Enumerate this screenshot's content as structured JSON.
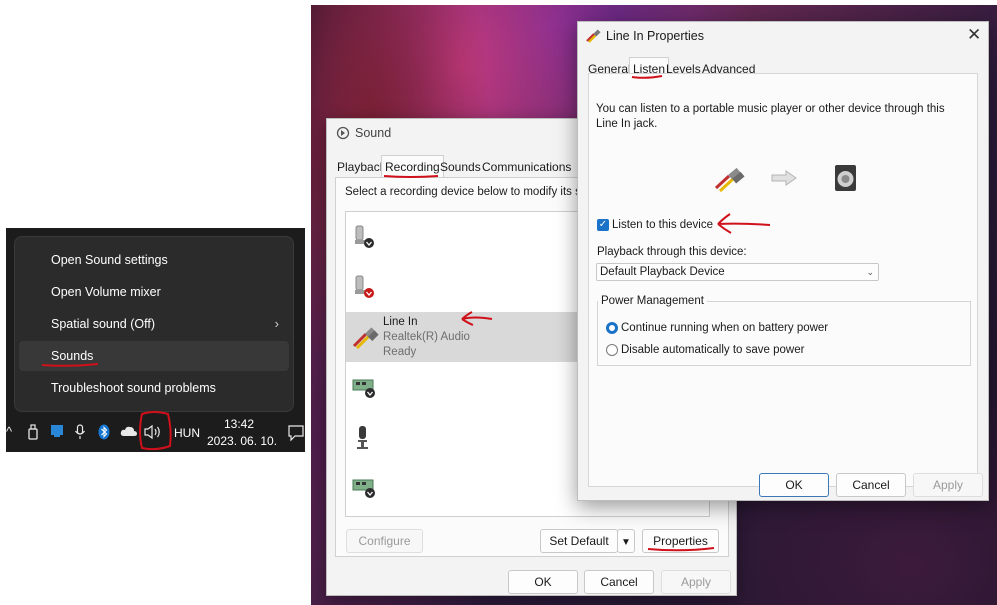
{
  "context_menu": {
    "items": [
      {
        "label": "Open Sound settings"
      },
      {
        "label": "Open Volume mixer"
      },
      {
        "label": "Spatial sound (Off)",
        "submenu": true
      },
      {
        "label": "Sounds"
      },
      {
        "label": "Troubleshoot sound problems"
      }
    ]
  },
  "taskbar": {
    "language": "HUN",
    "time": "13:42",
    "date": "2023. 06. 10."
  },
  "sound_dialog": {
    "title": "Sound",
    "tabs": [
      "Playback",
      "Recording",
      "Sounds",
      "Communications"
    ],
    "active_tab": "Recording",
    "instruction": "Select a recording device below to modify its set",
    "devices": [
      {
        "name": "",
        "detail": "",
        "status": ""
      },
      {
        "name": "",
        "detail": "",
        "status": ""
      },
      {
        "name": "Line In",
        "detail": "Realtek(R) Audio",
        "status": "Ready"
      },
      {
        "name": "",
        "detail": "",
        "status": ""
      },
      {
        "name": "",
        "detail": "",
        "status": ""
      },
      {
        "name": "",
        "detail": "",
        "status": ""
      }
    ],
    "buttons": {
      "configure": "Configure",
      "set_default": "Set Default",
      "properties": "Properties",
      "ok": "OK",
      "cancel": "Cancel",
      "apply": "Apply"
    }
  },
  "props_dialog": {
    "title": "Line In Properties",
    "tabs": [
      "General",
      "Listen",
      "Levels",
      "Advanced"
    ],
    "active_tab": "Listen",
    "description": "You can listen to a portable music player or other device through this Line In jack.",
    "listen_checkbox_label": "Listen to this device",
    "listen_checked": true,
    "playback_label": "Playback through this device:",
    "playback_value": "Default Playback Device",
    "power_group_label": "Power Management",
    "power_options": [
      {
        "label": "Continue running when on battery power",
        "selected": true
      },
      {
        "label": "Disable automatically to save power",
        "selected": false
      }
    ],
    "buttons": {
      "ok": "OK",
      "cancel": "Cancel",
      "apply": "Apply"
    }
  },
  "colors": {
    "annotation": "#d0101a",
    "accent": "#1a73c9"
  }
}
